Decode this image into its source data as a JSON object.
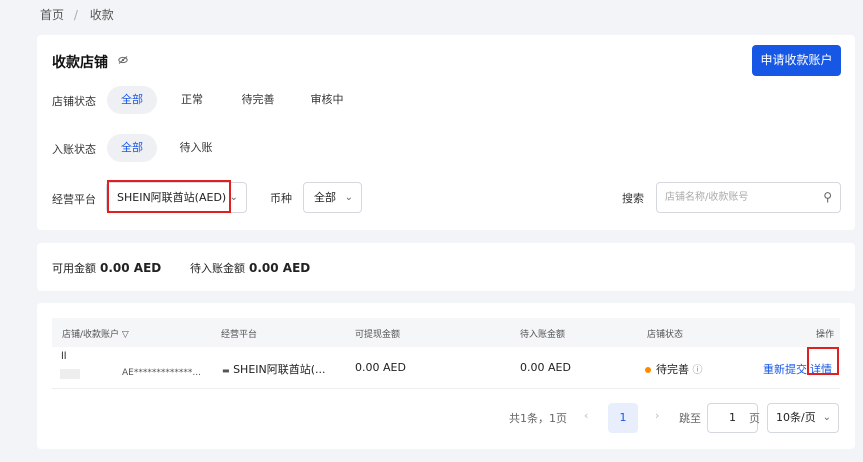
{
  "breadcrumb": {
    "home": "首页",
    "sep": "/",
    "current": "收款"
  },
  "header": {
    "title": "收款店铺",
    "apply_button": "申请收款账户"
  },
  "filters": {
    "store_status": {
      "label": "店铺状态",
      "options": [
        "全部",
        "正常",
        "待完善",
        "审核中"
      ],
      "selected": "全部"
    },
    "entry_status": {
      "label": "入账状态",
      "options": [
        "全部",
        "待入账"
      ],
      "selected": "全部"
    },
    "platform": {
      "label": "经营平台",
      "value": "SHEIN阿联酋站(AED)"
    },
    "currency": {
      "label": "币种",
      "value": "全部"
    },
    "search": {
      "label": "搜索",
      "placeholder": "店铺名称/收款账号"
    }
  },
  "balances": {
    "available_label": "可用金额",
    "available_value": "0.00 AED",
    "pending_label": "待入账金额",
    "pending_value": "0.00 AED"
  },
  "table": {
    "headers": [
      "店铺/收款账户",
      "经营平台",
      "可提现金额",
      "待入账金额",
      "店铺状态",
      "操作"
    ],
    "row": {
      "store_name": "ll",
      "account": "AE*************...",
      "platform": "SHEIN阿联酋站(...",
      "withdrawable": "0.00 AED",
      "pending": "0.00 AED",
      "status": "待完善",
      "action_resubmit": "重新提交",
      "action_detail": "详情"
    }
  },
  "pagination": {
    "summary": "共1条，1页",
    "current_page": "1",
    "jump_label": "跳至",
    "jump_value": "1",
    "page_unit": "页",
    "page_size": "10条/页"
  },
  "colors": {
    "primary": "#1757e6",
    "highlight": "#e02020",
    "status_pending": "#ff8a00"
  }
}
